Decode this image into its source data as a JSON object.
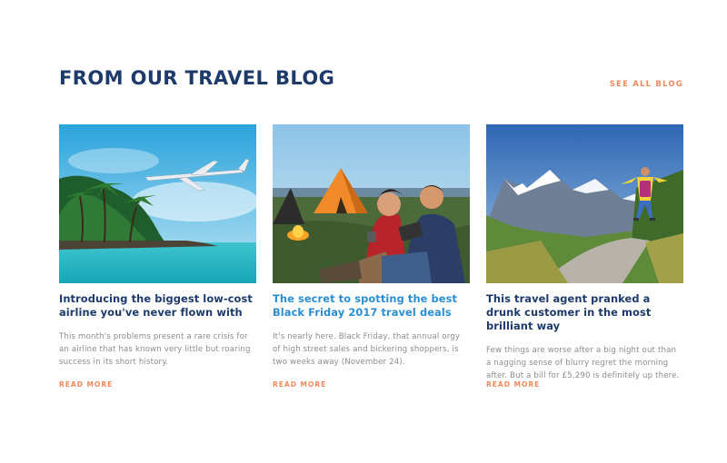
{
  "header": {
    "title": "FROM OUR TRAVEL BLOG",
    "see_all_label": "SEE ALL BLOG"
  },
  "posts": [
    {
      "title": "Introducing the biggest low-cost airline you've never flown with",
      "excerpt": "This month's problems present a rare crisis for an airline that has known very little but roaring success in its short history.",
      "read_more": "READ MORE",
      "image_subject": "airplane over tropical island"
    },
    {
      "title": "The secret to spotting the best Black Friday 2017 travel deals",
      "excerpt": "It's nearly here. Black Friday, that annual orgy of high street sales and bickering shoppers, is two weeks away (November 24).",
      "read_more": "READ MORE",
      "image_subject": "couple camping with tablet"
    },
    {
      "title": "This travel agent pranked a drunk customer in the most brilliant way",
      "excerpt": "Few things are worse after a big night out than a nagging sense of blurry regret the morning after. But a bill for £5,290 is definitely up there.",
      "read_more": "READ MORE",
      "image_subject": "hiker jumping on mountain road"
    }
  ],
  "colors": {
    "heading": "#1d3a6b",
    "accent": "#f08a5b",
    "link_active": "#2b8ed1",
    "body_text": "#8c8c8c"
  }
}
